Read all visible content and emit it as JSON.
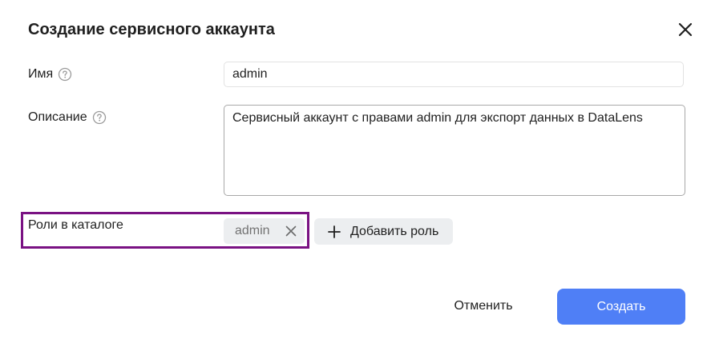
{
  "dialog": {
    "title": "Создание сервисного аккаунта"
  },
  "form": {
    "name": {
      "label": "Имя",
      "value": "admin"
    },
    "description": {
      "label": "Описание",
      "value": "Сервисный аккаунт с правами admin для экспорт данных в DataLens"
    },
    "roles": {
      "label": "Роли в каталоге",
      "chips": [
        "admin"
      ],
      "add_label": "Добавить роль"
    }
  },
  "footer": {
    "cancel_label": "Отменить",
    "create_label": "Создать"
  },
  "colors": {
    "primary": "#4f7ff6",
    "highlight_border": "#7a1283",
    "chip_background": "#eceef0"
  },
  "icons": {
    "close": "close-icon",
    "help": "question-circle-icon",
    "remove": "close-icon",
    "add": "plus-icon"
  }
}
